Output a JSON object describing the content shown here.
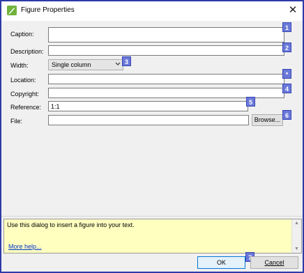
{
  "window": {
    "title": "Figure Properties",
    "close_glyph": "✕"
  },
  "form": {
    "caption_label": "Caption:",
    "caption_value": "",
    "description_label": "Description:",
    "description_value": "",
    "width_label": "Width:",
    "width_value": "Single column",
    "location_label": "Location:",
    "location_value": "",
    "copyright_label": "Copyright:",
    "copyright_value": "",
    "reference_label": "Reference:",
    "reference_value": "1:1",
    "file_label": "File:",
    "file_value": "",
    "browse_label": "Browse..."
  },
  "badges": [
    "1",
    "2",
    "3",
    "*",
    "4",
    "5",
    "6",
    "7"
  ],
  "help": {
    "text": "Use this dialog to insert a figure into your text.",
    "link": "More help..."
  },
  "buttons": {
    "ok": "OK",
    "cancel": "Cancel"
  },
  "colors": {
    "window_border": "#2e3aa8",
    "badge_fill": "#6a78d8",
    "help_background": "#ffffc0",
    "link": "#0033cc",
    "ok_border": "#0078d7"
  },
  "icons": {
    "app": "green-leaf-pen-icon",
    "close": "close-icon",
    "dropdown": "chevron-down-icon"
  }
}
